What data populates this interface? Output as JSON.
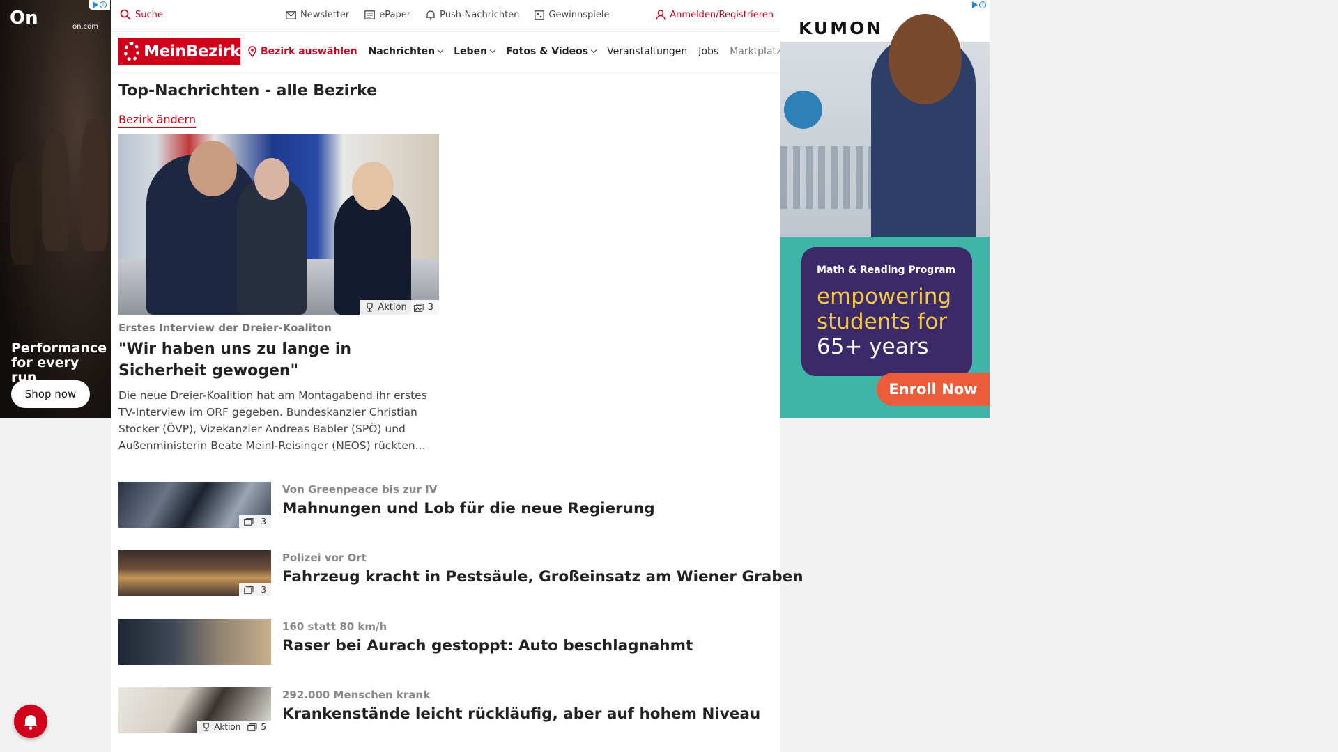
{
  "ad_left": {
    "logo": "On",
    "domain": "on.com",
    "tagline": "Performance for every run",
    "cta": "Shop now"
  },
  "topbar": {
    "search": "Suche",
    "links": [
      "Newsletter",
      "ePaper",
      "Push-Nachrichten",
      "Gewinnspiele"
    ],
    "login": "Anmelden/Registrieren"
  },
  "nav": {
    "brand": "MeinBezirk",
    "select_district": "Bezirk auswählen",
    "items": [
      {
        "label": "Nachrichten",
        "dropdown": true
      },
      {
        "label": "Leben",
        "dropdown": true
      },
      {
        "label": "Fotos & Videos",
        "dropdown": true
      },
      {
        "label": "Veranstaltungen",
        "dropdown": false
      },
      {
        "label": "Jobs",
        "dropdown": false
      },
      {
        "label": "Marktplatz",
        "dropdown": false
      }
    ]
  },
  "page": {
    "title": "Top-Nachrichten - alle Bezirke",
    "change_district": "Bezirk ändern"
  },
  "lead": {
    "badge_action": "Aktion",
    "badge_photos": "3",
    "kicker": "Erstes Interview der Dreier-Koaliton",
    "headline": "\"Wir haben uns zu lange in Sicherheit gewogen\"",
    "teaser": "Die neue Dreier-Koalition hat am Montagabend ihr erstes TV-Interview im ORF gegeben. Bundeskanzler Christian Stocker (ÖVP), Vizekanzler Andreas Babler (SPÖ) und Außenministerin Beate Meinl-Reisinger (NEOS) rückten..."
  },
  "articles": [
    {
      "kicker": "Von Greenpeace bis zur IV",
      "headline": "Mahnungen und Lob für die neue Regierung",
      "action": "",
      "photos": "3"
    },
    {
      "kicker": "Polizei vor Ort",
      "headline": "Fahrzeug kracht in Pestsäule, Großeinsatz am Wiener Graben",
      "action": "",
      "photos": "3"
    },
    {
      "kicker": "160 statt 80 km/h",
      "headline": "Raser bei Aurach gestoppt: Auto beschlagnahmt",
      "action": "",
      "photos": ""
    },
    {
      "kicker": "292.000 Menschen krank",
      "headline": "Krankenstände leicht rückläufig, aber auf hohem Niveau",
      "action": "Aktion",
      "photos": "5"
    }
  ],
  "ad_right": {
    "brand": "KUMON",
    "program": "Math & Reading Program",
    "line1": "empowering students for",
    "line2": "65+ years",
    "cta": "Enroll Now"
  },
  "colors": {
    "brand_red": "#d0021b",
    "kumon_teal": "#3fb5a8",
    "kumon_purple": "#3a2a6a",
    "kumon_orange": "#ec5b3a"
  }
}
